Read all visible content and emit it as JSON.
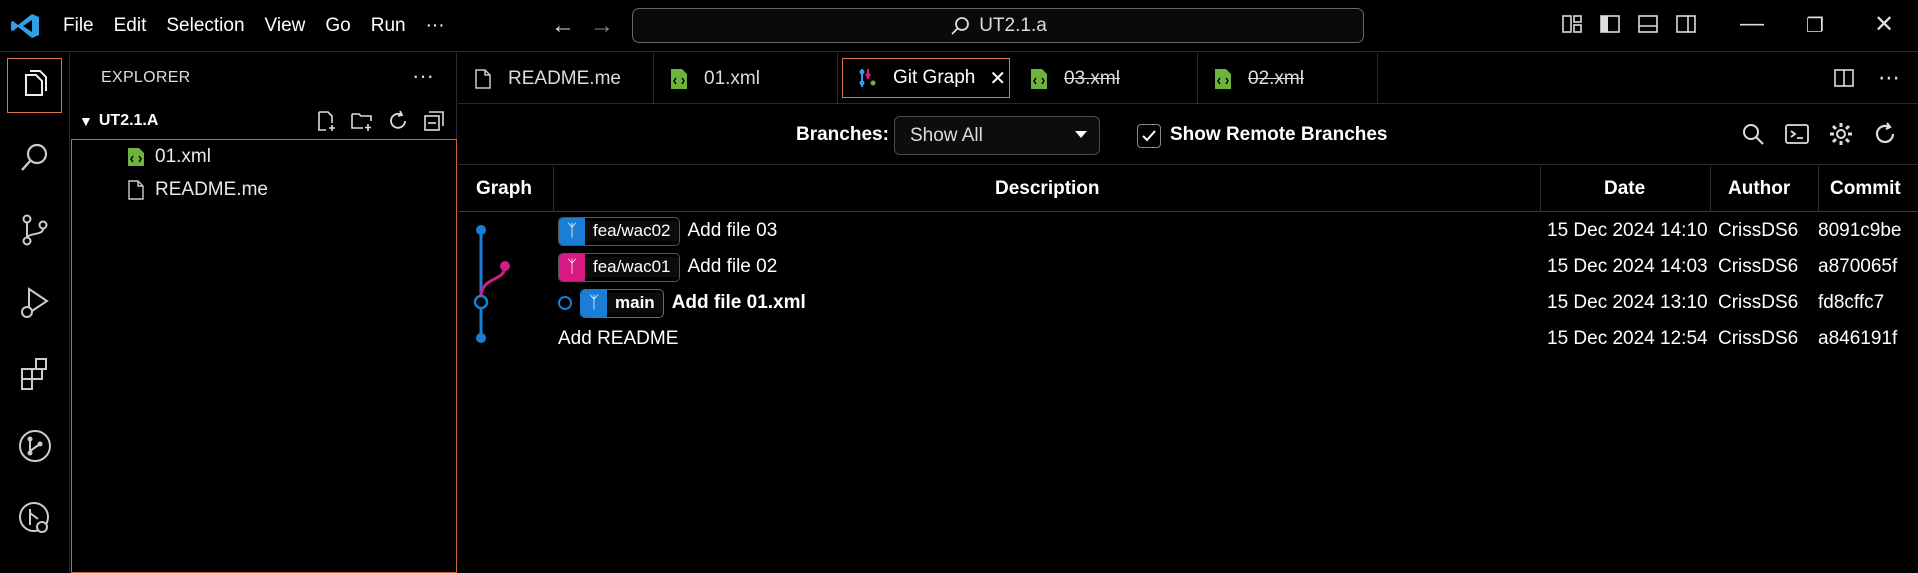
{
  "titlebar": {
    "menu": [
      "File",
      "Edit",
      "Selection",
      "View",
      "Go",
      "Run",
      "···"
    ],
    "search_text": "UT2.1.a"
  },
  "activity": [
    "explorer-icon",
    "search-icon",
    "source-control-icon",
    "run-debug-icon",
    "extensions-icon",
    "git-graph-icon",
    "git-history-icon"
  ],
  "sidebar": {
    "title": "EXPLORER",
    "more": "···",
    "folder": "UT2.1.A",
    "files": [
      {
        "name": "01.xml",
        "icon": "xml-file-icon"
      },
      {
        "name": "README.me",
        "icon": "file-icon"
      }
    ]
  },
  "tabs": [
    {
      "label": "README.me",
      "icon": "file-icon",
      "active": false,
      "deleted": false
    },
    {
      "label": "01.xml",
      "icon": "xml-file-icon",
      "active": false,
      "deleted": false
    },
    {
      "label": "Git Graph",
      "icon": "git-graph-icon",
      "active": true,
      "deleted": false
    },
    {
      "label": "03.xml",
      "icon": "xml-file-icon",
      "active": false,
      "deleted": true
    },
    {
      "label": "02.xml",
      "icon": "xml-file-icon",
      "active": false,
      "deleted": true
    }
  ],
  "toolbar": {
    "branches_label": "Branches:",
    "branches_value": "Show All",
    "remote_label": "Show Remote Branches",
    "remote_checked": true
  },
  "table": {
    "headers": {
      "graph": "Graph",
      "description": "Description",
      "date": "Date",
      "author": "Author",
      "commit": "Commit"
    },
    "rows": [
      {
        "ref": "fea/wac02",
        "ref_color": "#1a7fd4",
        "description": "Add file 03",
        "date": "15 Dec 2024 14:10",
        "author": "CrissDS6",
        "commit": "8091c9be",
        "bold": false
      },
      {
        "ref": "fea/wac01",
        "ref_color": "#d81b84",
        "description": "Add file 02",
        "date": "15 Dec 2024 14:03",
        "author": "CrissDS6",
        "commit": "a870065f",
        "bold": false
      },
      {
        "ref": "main",
        "ref_color": "#1a7fd4",
        "description": "Add file 01.xml",
        "date": "15 Dec 2024 13:10",
        "author": "CrissDS6",
        "commit": "fd8cffc7",
        "bold": true
      },
      {
        "ref": "",
        "ref_color": "",
        "description": "Add README",
        "date": "15 Dec 2024 12:54",
        "author": "CrissDS6",
        "commit": "a846191f",
        "bold": false
      }
    ]
  },
  "colors": {
    "accent": "#e0734a",
    "blue": "#1a7fd4",
    "magenta": "#d81b84",
    "xml_green": "#6fb33f"
  }
}
